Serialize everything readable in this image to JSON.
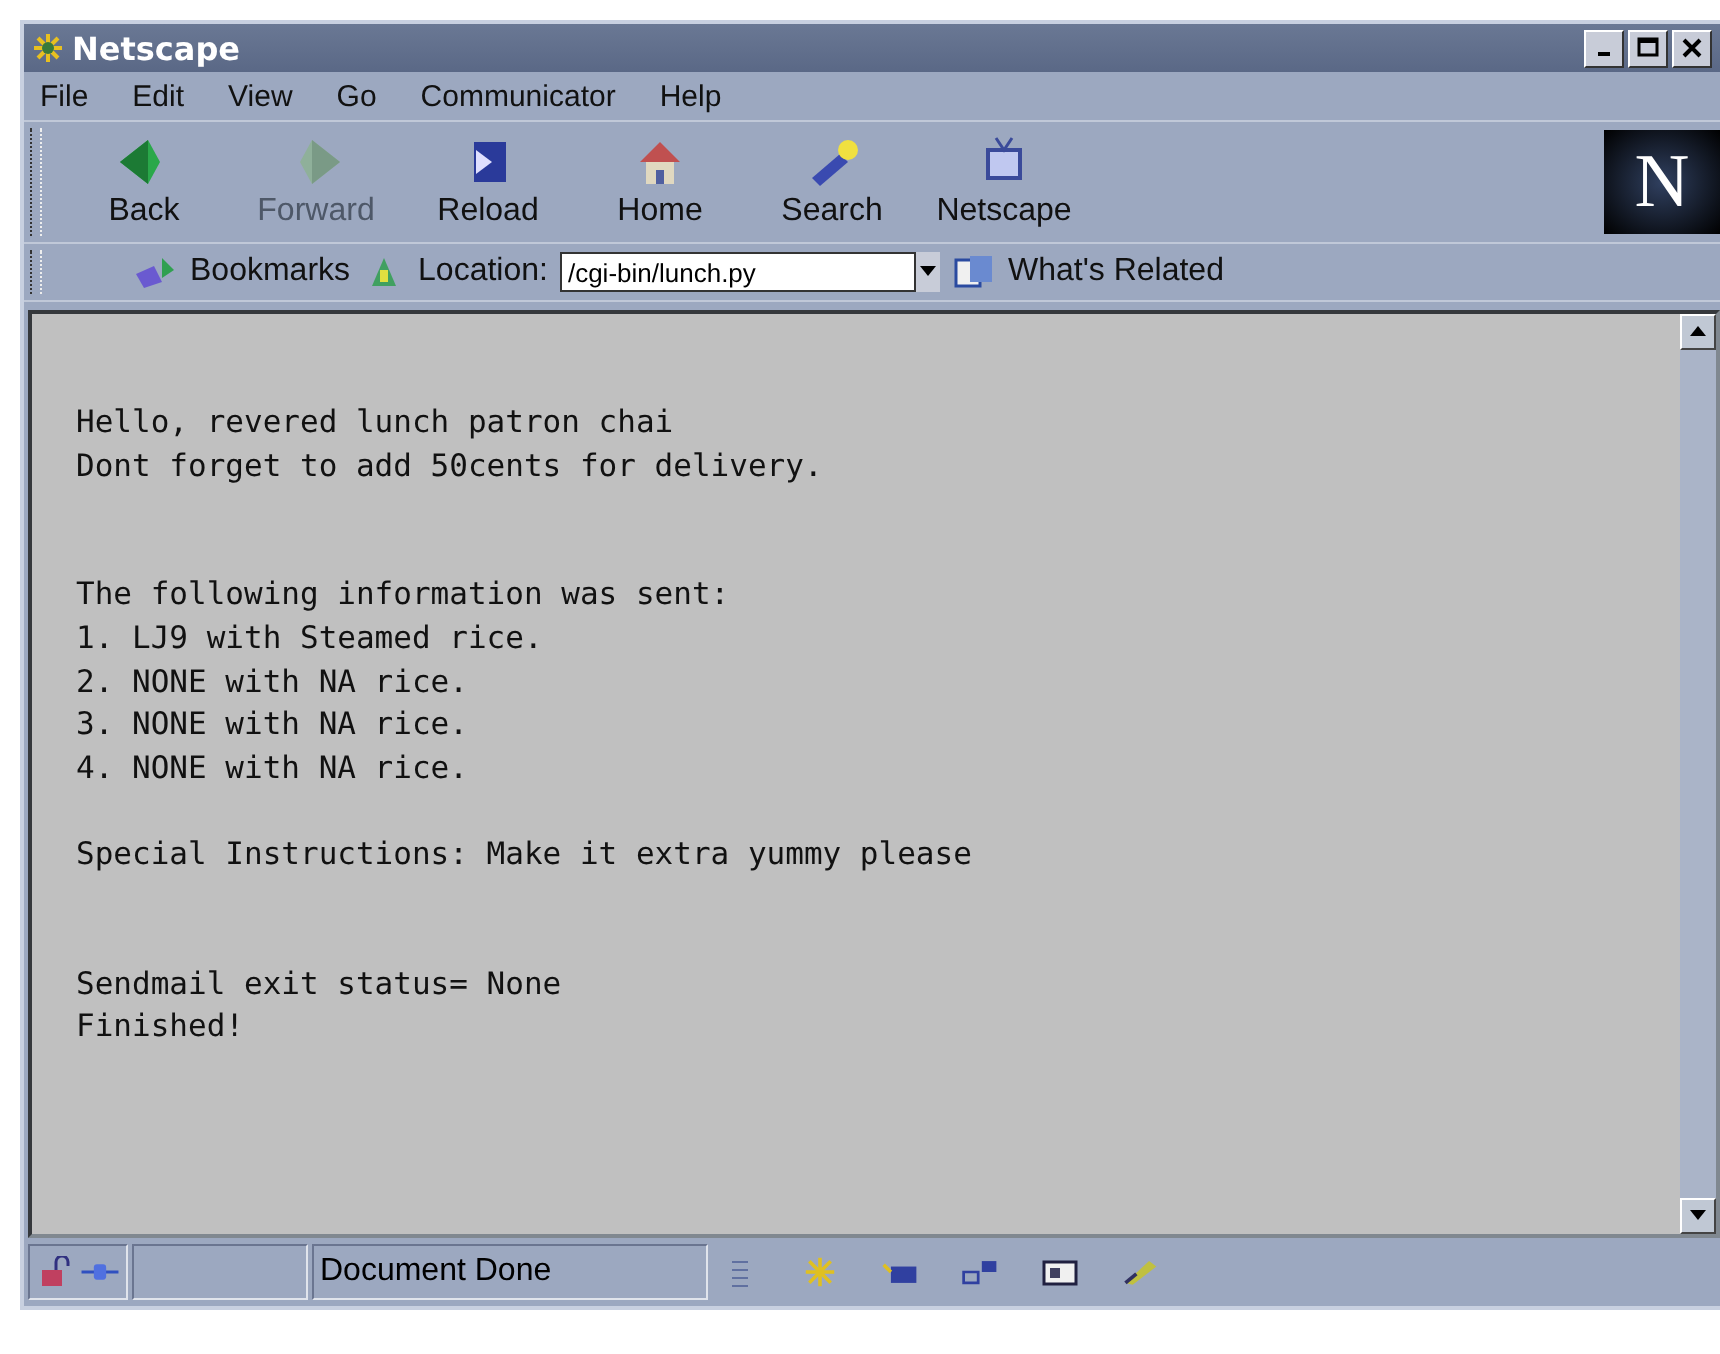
{
  "window": {
    "title": "Netscape"
  },
  "menu": [
    "File",
    "Edit",
    "View",
    "Go",
    "Communicator",
    "Help"
  ],
  "toolbar": [
    {
      "label": "Back",
      "kind": "back",
      "disabled": false
    },
    {
      "label": "Forward",
      "kind": "forward",
      "disabled": true
    },
    {
      "label": "Reload",
      "kind": "reload",
      "disabled": false
    },
    {
      "label": "Home",
      "kind": "home",
      "disabled": false
    },
    {
      "label": "Search",
      "kind": "search",
      "disabled": false
    },
    {
      "label": "Netscape",
      "kind": "netscape",
      "disabled": false
    }
  ],
  "logo": "N",
  "location_bar": {
    "bookmarks": "Bookmarks",
    "location_label": "Location:",
    "url": "/cgi-bin/lunch.py",
    "related": "What's Related"
  },
  "content": [
    {
      "kind": "text",
      "text": "Hello, revered lunch patron chai"
    },
    {
      "kind": "text",
      "text": "Dont forget to add 50cents for delivery."
    },
    {
      "kind": "blank"
    },
    {
      "kind": "blank"
    },
    {
      "kind": "text",
      "text": "The following information was sent:"
    },
    {
      "kind": "text",
      "text": "1. LJ9 with Steamed rice."
    },
    {
      "kind": "text",
      "text": "2. NONE with NA rice."
    },
    {
      "kind": "text",
      "text": "3. NONE with NA rice."
    },
    {
      "kind": "text",
      "text": "4. NONE with NA rice."
    },
    {
      "kind": "blank"
    },
    {
      "kind": "text",
      "text": "Special Instructions: Make it extra yummy please"
    },
    {
      "kind": "blank"
    },
    {
      "kind": "blank"
    },
    {
      "kind": "text",
      "text": "Sendmail exit status= None"
    },
    {
      "kind": "text",
      "text": "Finished!"
    }
  ],
  "status_bar": {
    "text": "Document Done"
  }
}
